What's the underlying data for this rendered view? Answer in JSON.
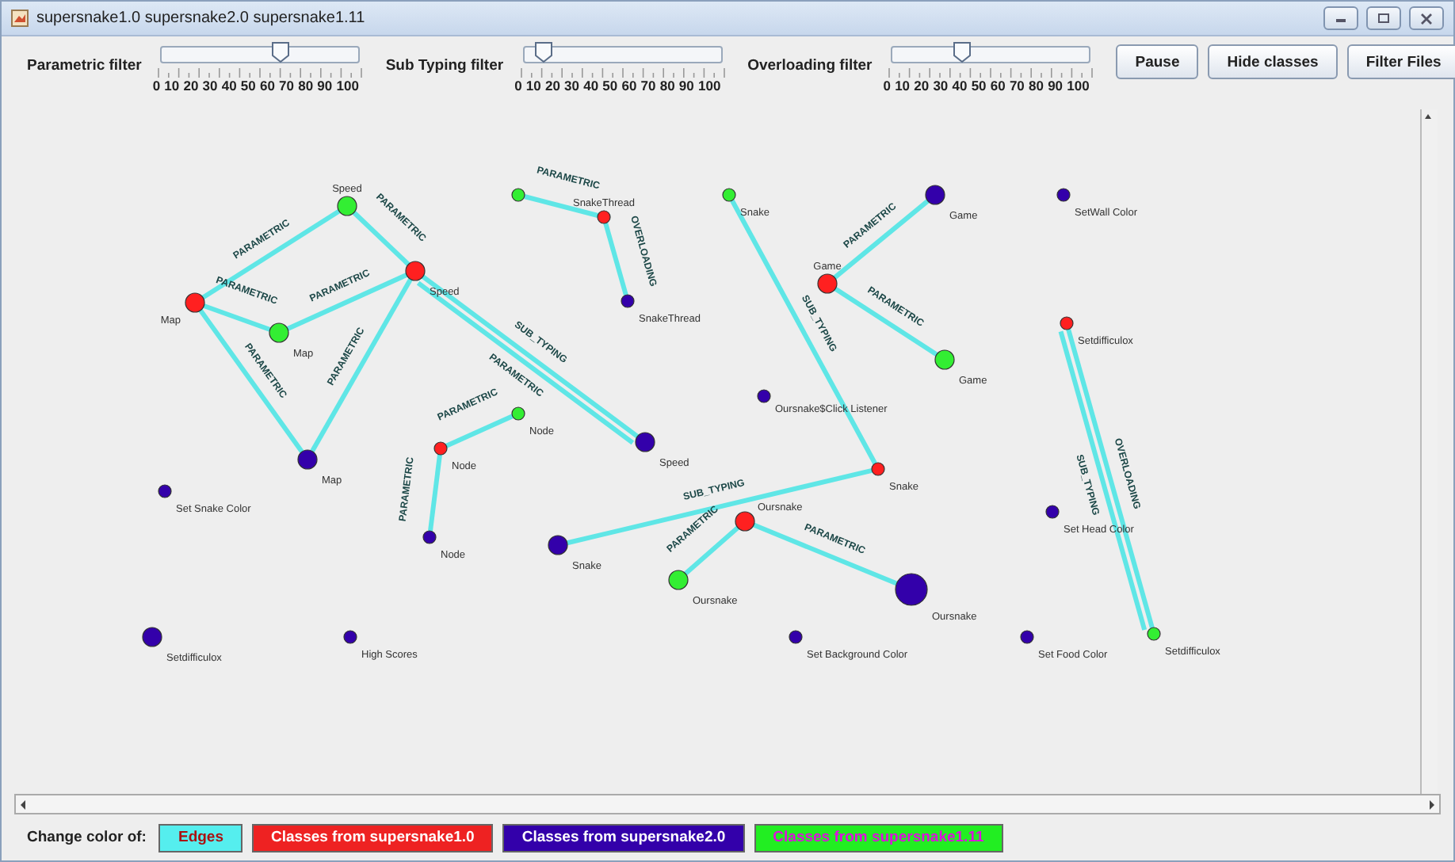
{
  "window": {
    "title": "supersnake1.0 supersnake2.0 supersnake1.11"
  },
  "filters": [
    {
      "label": "Parametric filter",
      "level": 0.6,
      "tick_labels": [
        "0",
        "10",
        "20",
        "30",
        "40",
        "50",
        "60",
        "70",
        "80",
        "90",
        "100"
      ]
    },
    {
      "label": "Sub Typing filter",
      "level": 0.1,
      "tick_labels": [
        "0",
        "10",
        "20",
        "30",
        "40",
        "50",
        "60",
        "70",
        "80",
        "90",
        "100"
      ]
    },
    {
      "label": "Overloading filter",
      "level": 0.35,
      "tick_labels": [
        "0",
        "10",
        "20",
        "30",
        "40",
        "50",
        "60",
        "70",
        "80",
        "90",
        "100"
      ]
    }
  ],
  "buttons": [
    "Pause",
    "Hide classes",
    "Filter Files"
  ],
  "graph": {
    "nodes": [
      {
        "color": "#33ee33",
        "kind": "small"
      },
      {
        "label": "Snake",
        "color": "#33ee33",
        "kind": "small"
      },
      {
        "label": "Game",
        "color": "#3300aa",
        "kind": "medium"
      },
      {
        "label": "SetWall Color",
        "color": "#3300aa",
        "kind": "small"
      },
      {
        "label": "Speed",
        "color": "#33ee33",
        "kind": "medium"
      },
      {
        "label": "SnakeThread",
        "color": "#ff2020",
        "kind": "small"
      },
      {
        "label": "Speed",
        "color": "#ff2020",
        "kind": "medium"
      },
      {
        "label": "Game",
        "color": "#ff2020",
        "kind": "medium"
      },
      {
        "label": "SnakeThread",
        "color": "#3300aa",
        "kind": "small"
      },
      {
        "label": "Map",
        "color": "#ff2020",
        "kind": "medium"
      },
      {
        "label": "Setdifficulox",
        "color": "#ff2020",
        "kind": "small"
      },
      {
        "label": "Map",
        "color": "#33ee33",
        "kind": "medium"
      },
      {
        "label": "Game",
        "color": "#33ee33",
        "kind": "medium"
      },
      {
        "label": "Oursnake$Click Listener",
        "color": "#3300aa",
        "kind": "small"
      },
      {
        "label": "Node",
        "color": "#33ee33",
        "kind": "small"
      },
      {
        "label": "Speed",
        "color": "#3300aa",
        "kind": "medium"
      },
      {
        "label": "Node",
        "color": "#ff2020",
        "kind": "small"
      },
      {
        "label": "Map",
        "color": "#3300aa",
        "kind": "medium"
      },
      {
        "label": "Snake",
        "color": "#ff2020",
        "kind": "small"
      },
      {
        "label": "Set Snake Color",
        "color": "#3300aa",
        "kind": "small"
      },
      {
        "label": "Set Head Color",
        "color": "#3300aa",
        "kind": "small"
      },
      {
        "label": "Oursnake",
        "color": "#ff2020",
        "kind": "medium"
      },
      {
        "label": "Node",
        "color": "#3300aa",
        "kind": "small"
      },
      {
        "label": "Snake",
        "color": "#3300aa",
        "kind": "medium"
      },
      {
        "label": "Oursnake",
        "color": "#33ee33",
        "kind": "medium"
      },
      {
        "label": "Oursnake",
        "color": "#3300aa",
        "kind": "large"
      },
      {
        "label": "Setdifficulox",
        "color": "#33ee33",
        "kind": "small"
      },
      {
        "label": "Setdifficulox",
        "color": "#3300aa",
        "kind": "medium"
      },
      {
        "label": "High Scores",
        "color": "#3300aa",
        "kind": "small"
      },
      {
        "label": "Set Background Color",
        "color": "#3300aa",
        "kind": "small"
      },
      {
        "label": "Set Food Color",
        "color": "#3300aa",
        "kind": "small"
      }
    ],
    "edges": [
      {
        "label": "PARAMETRIC"
      },
      {
        "label": "PARAMETRIC"
      },
      {
        "label": "PARAMETRIC"
      },
      {
        "label": "PARAMETRIC"
      },
      {
        "label": "PARAMETRIC"
      },
      {
        "label": "PARAMETRIC"
      },
      {
        "label": "SUB_TYPING"
      },
      {
        "label": "PARAMETRIC"
      },
      {
        "label": "PARAMETRIC"
      },
      {
        "label": "OVERLOADING"
      },
      {
        "label": "PARAMETRIC"
      },
      {
        "label": "PARAMETRIC"
      },
      {
        "label": "SUB_TYPING"
      },
      {
        "label": "SUB_TYPING"
      },
      {
        "label": "PARAMETRIC"
      },
      {
        "label": "PARAMETRIC"
      },
      {
        "label": "PARAMETRIC"
      },
      {
        "label": "PARAMETRIC"
      },
      {
        "label": "OVERLOADING"
      },
      {
        "label": "SUB_TYPING"
      }
    ]
  },
  "legend": {
    "label": "Change color of:",
    "items": [
      {
        "label": "Edges",
        "color": "#55eeee"
      },
      {
        "label": "Classes from supersnake1.0",
        "color": "#ee2222"
      },
      {
        "label": "Classes from supersnake2.0",
        "color": "#3300aa"
      },
      {
        "label": "Classes from supersnake1.11",
        "color": "#22ee22"
      }
    ]
  }
}
